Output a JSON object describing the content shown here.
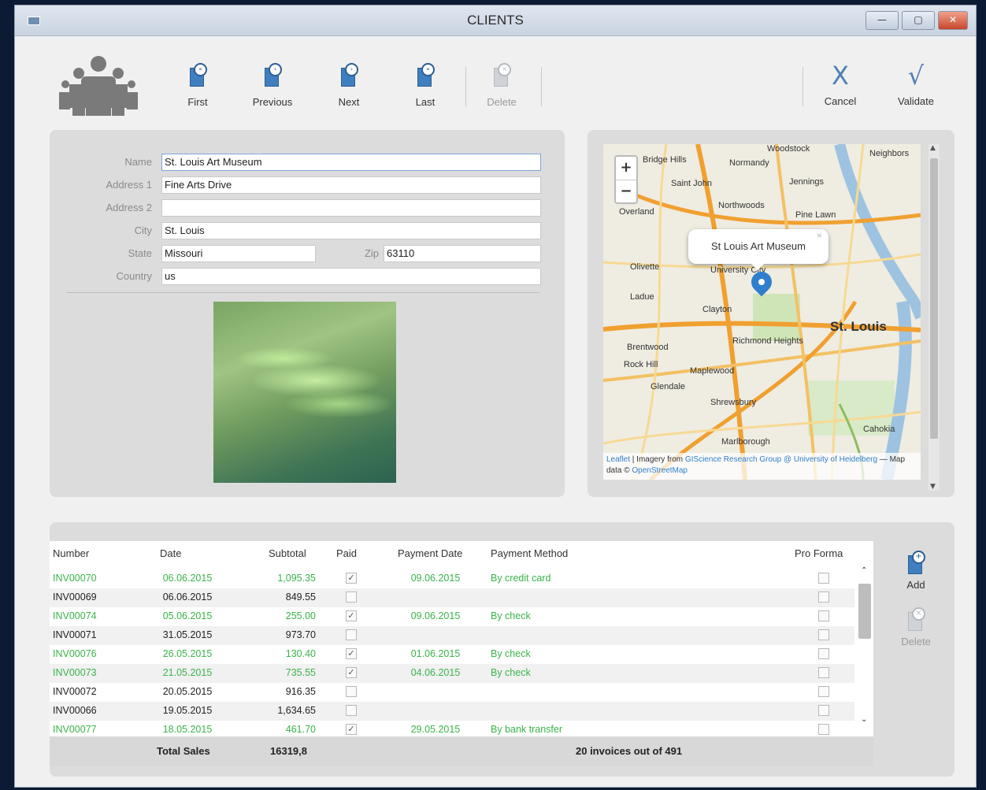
{
  "window": {
    "title": "CLIENTS",
    "minimize": "—",
    "maximize": "▢",
    "close": "✕"
  },
  "toolbar": {
    "first": "First",
    "previous": "Previous",
    "next": "Next",
    "last": "Last",
    "delete": "Delete",
    "cancel": "Cancel",
    "validate": "Validate"
  },
  "form": {
    "name_label": "Name",
    "name_value": "St. Louis Art Museum",
    "address1_label": "Address 1",
    "address1_value": "Fine Arts Drive",
    "address2_label": "Address 2",
    "address2_value": "",
    "city_label": "City",
    "city_value": "St. Louis",
    "state_label": "State",
    "state_value": "Missouri",
    "zip_label": "Zip",
    "zip_value": "63110",
    "country_label": "Country",
    "country_value": "us"
  },
  "map": {
    "zoom_in": "+",
    "zoom_out": "−",
    "popup": "St Louis Art Museum",
    "places": [
      "Woodstock",
      "Normandy",
      "Jennings",
      "Saint John",
      "Northwoods",
      "Pine Lawn",
      "Overland",
      "Olivette",
      "University City",
      "Ladue",
      "Clayton",
      "St. Louis",
      "Brentwood",
      "Richmond Heights",
      "Rock Hill",
      "Maplewood",
      "Glendale",
      "Shrewsbury",
      "Marlborough",
      "Cahokia",
      "Neighbors",
      "Bridge Hills"
    ],
    "attribution_leaflet": "Leaflet",
    "attribution_text1": " | Imagery from ",
    "attribution_link1": "GIScience Research Group @ University of Heidelberg",
    "attribution_text2": " — Map data © ",
    "attribution_link2": "OpenStreetMap"
  },
  "invoices": {
    "headers": {
      "number": "Number",
      "date": "Date",
      "subtotal": "Subtotal",
      "paid": "Paid",
      "payment_date": "Payment Date",
      "payment_method": "Payment Method",
      "pro_forma": "Pro Forma"
    },
    "rows": [
      {
        "number": "INV00070",
        "date": "06.06.2015",
        "subtotal": "1,095.35",
        "paid": "✓",
        "payment_date": "09.06.2015",
        "payment_method": "By credit card"
      },
      {
        "number": "INV00069",
        "date": "06.06.2015",
        "subtotal": "849.55",
        "paid": "",
        "payment_date": "",
        "payment_method": ""
      },
      {
        "number": "INV00074",
        "date": "05.06.2015",
        "subtotal": "255.00",
        "paid": "✓",
        "payment_date": "09.06.2015",
        "payment_method": "By check"
      },
      {
        "number": "INV00071",
        "date": "31.05.2015",
        "subtotal": "973.70",
        "paid": "",
        "payment_date": "",
        "payment_method": ""
      },
      {
        "number": "INV00076",
        "date": "26.05.2015",
        "subtotal": "130.40",
        "paid": "✓",
        "payment_date": "01.06.2015",
        "payment_method": "By check"
      },
      {
        "number": "INV00073",
        "date": "21.05.2015",
        "subtotal": "735.55",
        "paid": "✓",
        "payment_date": "04.06.2015",
        "payment_method": "By check"
      },
      {
        "number": "INV00072",
        "date": "20.05.2015",
        "subtotal": "916.35",
        "paid": "",
        "payment_date": "",
        "payment_method": ""
      },
      {
        "number": "INV00066",
        "date": "19.05.2015",
        "subtotal": "1,634.65",
        "paid": "",
        "payment_date": "",
        "payment_method": ""
      },
      {
        "number": "INV00077",
        "date": "18.05.2015",
        "subtotal": "461.70",
        "paid": "✓",
        "payment_date": "29.05.2015",
        "payment_method": "By bank transfer"
      }
    ],
    "total_label": "Total Sales",
    "total_value": "16319,8",
    "count_text": "20 invoices out of 491",
    "add": "Add",
    "delete": "Delete",
    "scroll_up": "⌃",
    "scroll_down": "⌄"
  },
  "colors": {
    "paid_green": "#39b54a",
    "accent_blue": "#3f7fc0"
  }
}
